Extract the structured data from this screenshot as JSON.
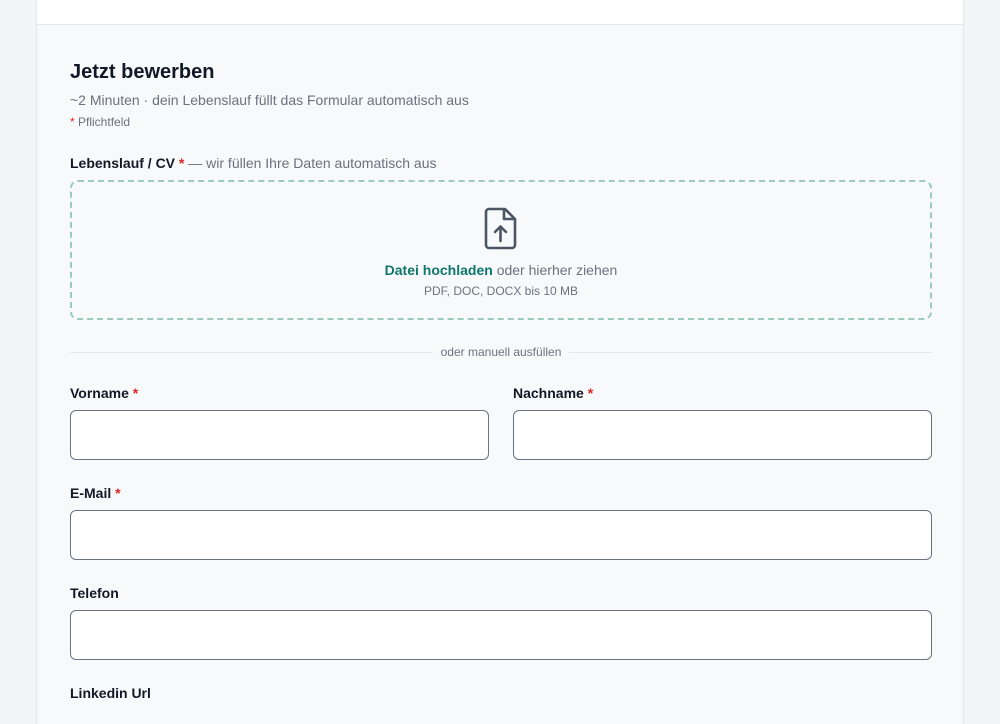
{
  "form": {
    "title": "Jetzt bewerben",
    "subtitle": "~2 Minuten · dein Lebenslauf füllt das Formular automatisch aus",
    "required_marker": "*",
    "required_note": "Pflichtfeld"
  },
  "upload": {
    "label": "Lebenslauf / CV",
    "hint": "— wir füllen Ihre Daten automatisch aus",
    "link_text": "Datei hochladen",
    "drag_text": "oder hierher ziehen",
    "formats": "PDF, DOC, DOCX bis 10 MB",
    "icon": "file-upload-icon"
  },
  "divider": {
    "text": "oder manuell ausfüllen"
  },
  "fields": {
    "first_name": {
      "label": "Vorname",
      "value": ""
    },
    "last_name": {
      "label": "Nachname",
      "value": ""
    },
    "email": {
      "label": "E-Mail",
      "value": ""
    },
    "phone": {
      "label": "Telefon",
      "value": ""
    },
    "linkedin": {
      "label": "Linkedin Url"
    }
  },
  "colors": {
    "accent": "#0f766e",
    "required": "#dc2626",
    "dashed_border": "#9ccbb9",
    "muted_text": "#6b7280"
  }
}
